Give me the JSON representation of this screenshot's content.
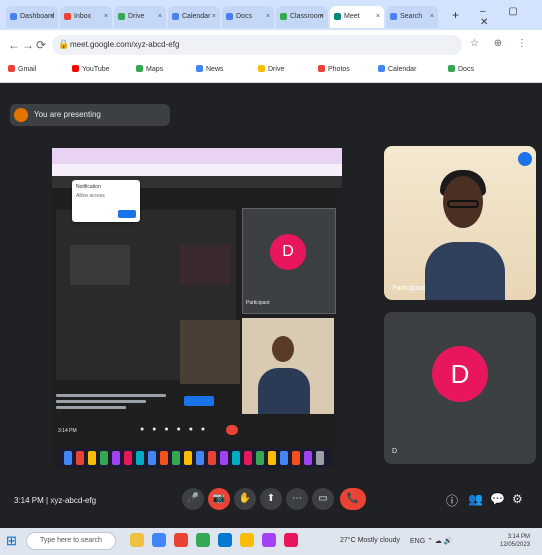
{
  "browser": {
    "tabs": [
      {
        "label": "Dashboard",
        "active": false
      },
      {
        "label": "Inbox",
        "active": false
      },
      {
        "label": "Drive",
        "active": false
      },
      {
        "label": "Calendar",
        "active": false
      },
      {
        "label": "Docs",
        "active": false
      },
      {
        "label": "Classroom",
        "active": false
      },
      {
        "label": "Meet",
        "active": true
      },
      {
        "label": "Search",
        "active": false
      }
    ],
    "new_tab_label": "+",
    "window_controls": "– ▢ ✕",
    "back_label": "←",
    "forward_label": "→",
    "reload_label": "⟳",
    "url": "meet.google.com/xyz-abcd-efg",
    "lock_label": "🔒",
    "toolbar_icons": "☆ ⊕ ⋮",
    "bookmarks": [
      {
        "label": "Gmail",
        "color": "#ea4335"
      },
      {
        "label": "YouTube",
        "color": "#ff0000"
      },
      {
        "label": "Maps",
        "color": "#34a853"
      },
      {
        "label": "News",
        "color": "#4285f4"
      },
      {
        "label": "Drive",
        "color": "#fbbc04"
      },
      {
        "label": "Photos",
        "color": "#ea4335"
      },
      {
        "label": "Calendar",
        "color": "#4285f4"
      },
      {
        "label": "Docs",
        "color": "#34a853"
      }
    ]
  },
  "meet": {
    "presenting_banner": "You are presenting",
    "shared_screen": {
      "popup_title": "Notification",
      "popup_text": "Allow access",
      "tile_name": "Participant",
      "time": "3:14 PM"
    },
    "participants": [
      {
        "name": "Participant",
        "type": "camera"
      },
      {
        "name": "D",
        "type": "avatar",
        "initial": "D",
        "avatar_color": "#e8175d"
      }
    ],
    "time_code": "3:14 PM | xyz-abcd-efg",
    "controls": [
      "🎤",
      "📷",
      "✋",
      "⬆",
      "⋯"
    ],
    "end_call_label": "📞",
    "right_controls": [
      "ⓘ",
      "👥",
      "💬",
      "⚙"
    ]
  },
  "os_taskbar": {
    "start_label": "⊞",
    "search_placeholder": "Type here to search",
    "weather": "27°C Mostly cloudy",
    "tray": "ENG ⌃ ☁ 🔊",
    "time": "3:14 PM",
    "date": "12/05/2023",
    "apps": [
      {
        "color": "#f0c040"
      },
      {
        "color": "#4285f4"
      },
      {
        "color": "#ea4335"
      },
      {
        "color": "#34a853"
      },
      {
        "color": "#0078d4"
      },
      {
        "color": "#fbbc04"
      },
      {
        "color": "#a142f4"
      },
      {
        "color": "#e8175d"
      }
    ]
  }
}
